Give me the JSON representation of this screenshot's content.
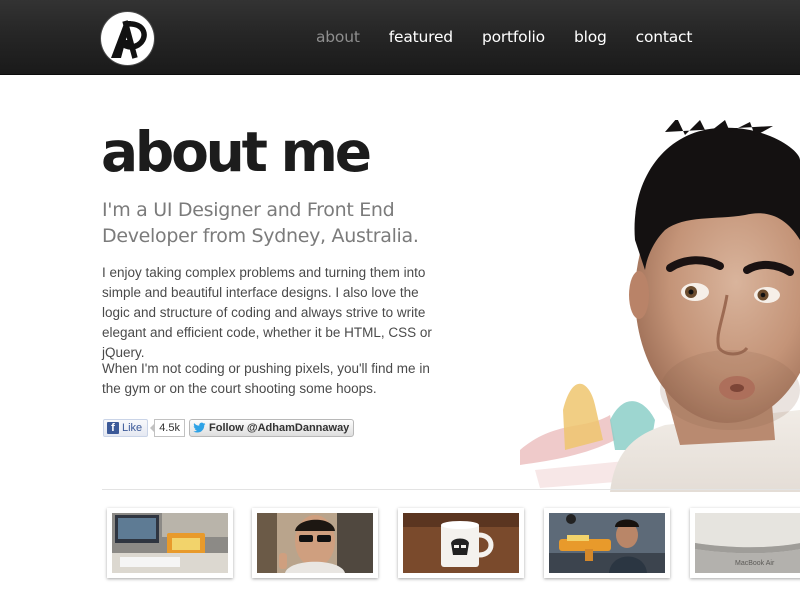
{
  "header": {
    "logo_text": "AP",
    "nav": [
      {
        "label": "about",
        "active": true
      },
      {
        "label": "featured",
        "active": false
      },
      {
        "label": "portfolio",
        "active": false
      },
      {
        "label": "blog",
        "active": false
      },
      {
        "label": "contact",
        "active": false
      }
    ]
  },
  "hero": {
    "title": "about me",
    "lead": "I'm a UI Designer and Front End Developer from Sydney, Australia.",
    "para1": "I enjoy taking complex problems and turning them into simple and beautiful interface designs. I also love the logic and structure of coding and always strive to write elegant and efficient code, whether it be HTML, CSS or jQuery.",
    "para2": "When I'm not coding or pushing pixels, you'll find me in the gym or on the court shooting some hoops."
  },
  "social": {
    "fb_like_label": "Like",
    "fb_like_count": "4.5k",
    "twitter_follow_label": "Follow @AdhamDannaway"
  },
  "thumbnails": [
    {
      "name": "desk-setup"
    },
    {
      "name": "sunglasses-selfie"
    },
    {
      "name": "stormtrooper-mug"
    },
    {
      "name": "toy-gun-photo"
    },
    {
      "name": "macbook-air",
      "caption": "MacBook Air"
    }
  ],
  "colors": {
    "header_bg": "#262626",
    "nav_active": "#8e8e8e",
    "nav_text": "#ffffff",
    "title": "#1c1c1c",
    "lead": "#7b7b7b",
    "body_text": "#4a4a4a"
  }
}
